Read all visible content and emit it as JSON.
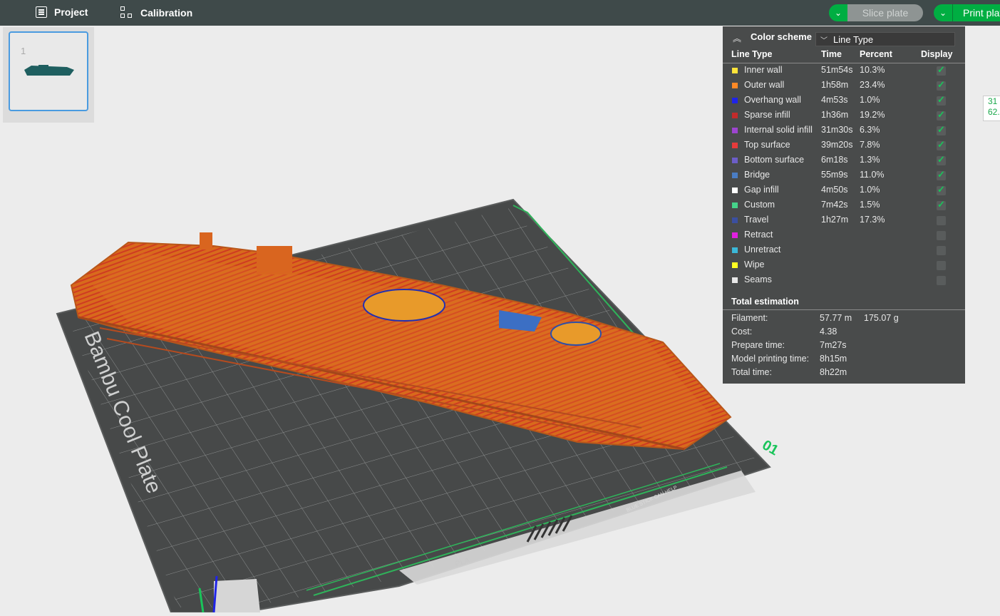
{
  "topbar": {
    "project_label": "Project",
    "calibration_label": "Calibration",
    "slice_label": "Slice plate",
    "print_label": "Print plate",
    "accent_color": "#00ae42"
  },
  "plate_list": {
    "plate_number": "1"
  },
  "scene": {
    "plate_text": "Bambu Cool Plate",
    "plate_id": "01",
    "material_label": "PLA",
    "notice_text": "BLUE STICK CAN HELP"
  },
  "legend": {
    "color_scheme_label": "Color scheme",
    "scheme_value": "Line Type",
    "columns": {
      "type": "Line Type",
      "time": "Time",
      "percent": "Percent",
      "display": "Display"
    },
    "rows": [
      {
        "name": "Inner wall",
        "time": "51m54s",
        "percent": "10.3%",
        "color": "#ffe43a",
        "display": true
      },
      {
        "name": "Outer wall",
        "time": "1h58m",
        "percent": "23.4%",
        "color": "#ff8a26",
        "display": true
      },
      {
        "name": "Overhang wall",
        "time": "4m53s",
        "percent": "1.0%",
        "color": "#1f24e8",
        "display": true
      },
      {
        "name": "Sparse infill",
        "time": "1h36m",
        "percent": "19.2%",
        "color": "#c22b2b",
        "display": true
      },
      {
        "name": "Internal solid infill",
        "time": "31m30s",
        "percent": "6.3%",
        "color": "#9d45d0",
        "display": true
      },
      {
        "name": "Top surface",
        "time": "39m20s",
        "percent": "7.8%",
        "color": "#e63b3b",
        "display": true
      },
      {
        "name": "Bottom surface",
        "time": "6m18s",
        "percent": "1.3%",
        "color": "#6c5ec8",
        "display": true
      },
      {
        "name": "Bridge",
        "time": "55m9s",
        "percent": "11.0%",
        "color": "#4a7dc4",
        "display": true
      },
      {
        "name": "Gap infill",
        "time": "4m50s",
        "percent": "1.0%",
        "color": "#ffffff",
        "display": true
      },
      {
        "name": "Custom",
        "time": "7m42s",
        "percent": "1.5%",
        "color": "#45d38a",
        "display": true
      },
      {
        "name": "Travel",
        "time": "1h27m",
        "percent": "17.3%",
        "color": "#3b4fa0",
        "display": false
      },
      {
        "name": "Retract",
        "time": "",
        "percent": "",
        "color": "#e020e0",
        "display": false
      },
      {
        "name": "Unretract",
        "time": "",
        "percent": "",
        "color": "#3bb8d8",
        "display": false
      },
      {
        "name": "Wipe",
        "time": "",
        "percent": "",
        "color": "#ffff22",
        "display": false
      },
      {
        "name": "Seams",
        "time": "",
        "percent": "",
        "color": "#e8e8e8",
        "display": false
      }
    ],
    "total_label": "Total estimation",
    "totals": {
      "filament_label": "Filament:",
      "filament_length": "57.77 m",
      "filament_weight": "175.07 g",
      "cost_label": "Cost:",
      "cost": "4.38",
      "prepare_label": "Prepare time:",
      "prepare": "7m27s",
      "model_label": "Model printing time:",
      "model": "8h15m",
      "total_label": "Total time:",
      "total": "8h22m"
    }
  },
  "side_readout": {
    "line1": "31",
    "line2": "62."
  }
}
